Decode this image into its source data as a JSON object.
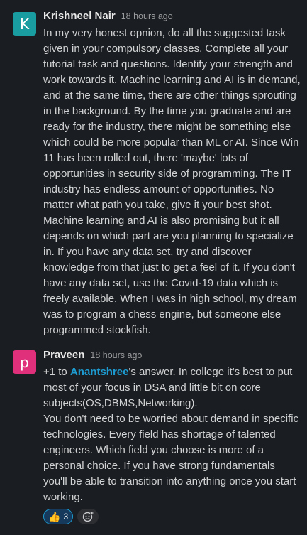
{
  "messages": [
    {
      "avatar_letter": "K",
      "avatar_color": "#1a9da0",
      "author": "Krishneel Nair",
      "time": "18 hours ago",
      "text": "In my very honest opnion, do all the suggested task given in your compulsory classes. Complete all your tutorial task and questions. Identify your strength and work towards it. Machine learning and AI is in demand, and at the same time, there are other things sprouting in the background. By the time you graduate and are ready for the industry, there might be something else which could be more popular than ML or AI. Since Win 11 has been rolled out, there 'maybe' lots of opportunities in security side of programming. The IT industry has endless amount of opportunities. No matter what path you take, give it your best shot. Machine learning and AI is also promising but it all depends on which part are you planning to specialize in. If you have any data set, try and discover knowledge from that just to get a feel of it. If you don't have any data set, use the Covid-19 data which is freely available. When I was in high school, my dream was to program a chess engine, but someone else programmed stockfish."
    },
    {
      "avatar_letter": "p",
      "avatar_color": "#e0307b",
      "author": "Praveen",
      "time": "18 hours ago",
      "text_prefix": "+1 to ",
      "mention": "Anantshree",
      "text_suffix": "'s answer. In college it's best to put most of your focus in DSA and little bit on core subjects(OS,DBMS,Networking).",
      "text_2": "You don't need to be worried about demand in specific technologies. Every field has shortage of talented engineers. Which field you choose is more of a personal choice. If you have strong fundamentals you'll be able to transition into anything once you start working.",
      "reaction": {
        "emoji": "👍",
        "count": "3"
      },
      "add_reaction_icon": "add-emoji-icon"
    }
  ]
}
